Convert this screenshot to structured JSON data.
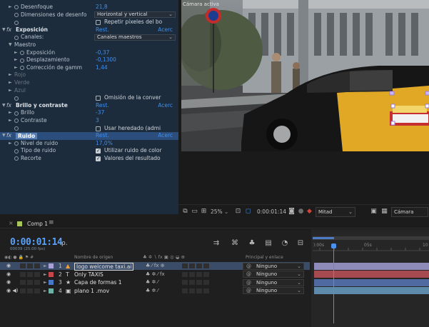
{
  "effects": {
    "rows": [
      {
        "kind": "prop",
        "indent": 1,
        "twirl": "►",
        "stopwatch": true,
        "label": "Desenfoque",
        "value": "21,8"
      },
      {
        "kind": "dropdown",
        "indent": 1,
        "stopwatch": true,
        "label": "Dimensiones de desenfo",
        "value": "Horizontal y vertical"
      },
      {
        "kind": "check",
        "indent": 1,
        "stopwatch": true,
        "label": "",
        "checked": false,
        "text": "Repetir píxeles del bo"
      },
      {
        "kind": "effect",
        "label": "Exposición",
        "aux": "Acerc",
        "value": "Rest."
      },
      {
        "kind": "dropdown",
        "indent": 1,
        "stopwatch": true,
        "label": "Canales:",
        "value": "Canales maestros"
      },
      {
        "kind": "group",
        "indent": 1,
        "twirl": "▼",
        "label": "Maestro"
      },
      {
        "kind": "prop",
        "indent": 2,
        "twirl": "►",
        "stopwatch": true,
        "label": "Exposición",
        "value": "-0,37"
      },
      {
        "kind": "prop",
        "indent": 2,
        "twirl": "►",
        "stopwatch": true,
        "label": "Desplazamiento",
        "value": "-0,1300"
      },
      {
        "kind": "prop",
        "indent": 2,
        "twirl": "►",
        "stopwatch": true,
        "label": "Corrección de gamm",
        "value": "1,44"
      },
      {
        "kind": "dim",
        "indent": 1,
        "twirl": "►",
        "label": "Rojo"
      },
      {
        "kind": "dim",
        "indent": 1,
        "twirl": "►",
        "label": "Verde"
      },
      {
        "kind": "dim",
        "indent": 1,
        "twirl": "►",
        "label": "Azul"
      },
      {
        "kind": "check",
        "indent": 1,
        "stopwatch": true,
        "label": "",
        "checked": false,
        "text": "Omisión de la conver"
      },
      {
        "kind": "effect",
        "label": "Brillo y contraste",
        "aux": "Acerc",
        "value": "Rest."
      },
      {
        "kind": "prop",
        "indent": 1,
        "twirl": "►",
        "stopwatch": true,
        "label": "Brillo",
        "value": "-37"
      },
      {
        "kind": "prop",
        "indent": 1,
        "twirl": "►",
        "stopwatch": true,
        "label": "Contraste",
        "value": "3"
      },
      {
        "kind": "check",
        "indent": 1,
        "stopwatch": true,
        "label": "",
        "checked": false,
        "text": "Usar heredado (admi"
      },
      {
        "kind": "effect-selected",
        "label": "Ruido",
        "aux": "Acerc",
        "value": "Rest."
      },
      {
        "kind": "prop",
        "indent": 1,
        "twirl": "►",
        "stopwatch": true,
        "label": "Nivel de ruido",
        "value": "17,0%"
      },
      {
        "kind": "check",
        "indent": 1,
        "stopwatch": true,
        "label": "Tipo de ruido",
        "checked": true,
        "text": "Utilizar ruido de color"
      },
      {
        "kind": "check",
        "indent": 1,
        "stopwatch": true,
        "label": "Recorte",
        "checked": true,
        "text": "Valores del resultado"
      }
    ]
  },
  "viewer": {
    "overlay_text": "Cámara activa",
    "toolbar": {
      "zoom": "25%",
      "timecode": "0:00:01:14",
      "resolution": "Mitad",
      "view": "Cámara"
    }
  },
  "timeline_tab": {
    "close": "×",
    "label": "Comp 1",
    "menu": "≡"
  },
  "timeline": {
    "timecode": "0:00:01:14",
    "subtimecode": "00039 (25.00 fps)",
    "search_icon": "ρ.",
    "columns": {
      "source": "Nombre de origen",
      "parent": "Principal y enlace",
      "icons_left": "◉◐ ● 🔒 ⚑ #",
      "switches": "♣ ✲ ∖ fx ▣ ◎ ◒ ⊕"
    },
    "ruler": {
      "labels": [
        "):00s",
        "05s",
        "10"
      ],
      "playhead_pct": 0.18
    },
    "layers": [
      {
        "num": "1",
        "name": "logo welcome taxi.ai",
        "type": "ai",
        "color": "#a9a0d8",
        "selected": true,
        "parent": "Ninguno",
        "bar_color": "#8f8bb8"
      },
      {
        "num": "2",
        "name": "Only TAXIS",
        "type": "text",
        "color": "#c4474d",
        "selected": false,
        "parent": "Ninguno",
        "bar_color": "#a44a50"
      },
      {
        "num": "3",
        "name": "Capa de formas 1",
        "type": "shape",
        "color": "#4a78c8",
        "selected": false,
        "parent": "Ninguno",
        "bar_color": "#4e6aa0"
      },
      {
        "num": "4",
        "name": "plano 1 .mov",
        "type": "footage",
        "color": "#6bb2a5",
        "selected": false,
        "parent": "Ninguno",
        "bar_color": "#5e8bab"
      }
    ]
  },
  "colors": {
    "accent": "#3d8ff0",
    "panel_bg": "#1c2c3d",
    "selection": "#2c4e7c",
    "timecode": "#5aa0f5"
  }
}
